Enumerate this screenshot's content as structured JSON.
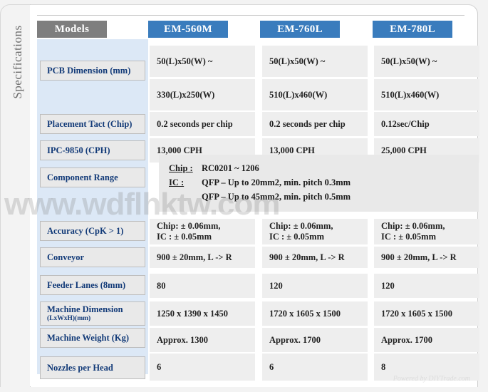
{
  "side_label": "Specifications",
  "header": {
    "spec_column_label": "Models",
    "models": [
      "EM-560M",
      "EM-760L",
      "EM-780L"
    ],
    "models_badge_color": "#7e7e7e",
    "model_badge_color": "#3a7cbd"
  },
  "rows": [
    {
      "label": "PCB Dimension (mm)",
      "sub": "",
      "values_top": [
        "50(L)x50(W) ~",
        "50(L)x50(W) ~",
        "50(L)x50(W) ~"
      ],
      "values_bottom": [
        "330(L)x250(W)",
        "510(L)x460(W)",
        "510(L)x460(W)"
      ]
    },
    {
      "label": "Placement Tact (Chip)",
      "sub": "",
      "values": [
        "0.2 seconds per chip",
        "0.2 seconds per chip",
        "0.12sec/Chip"
      ]
    },
    {
      "label": "IPC-9850 (CPH)",
      "sub": "",
      "values": [
        "13,000 CPH",
        "13,000 CPH",
        "25,000 CPH"
      ]
    },
    {
      "label": "Component Range",
      "sub": "",
      "merged": true
    },
    {
      "label": "Accuracy (CpK > 1)",
      "sub": "",
      "values": [
        "Chip: ± 0.06mm,\nIC : ± 0.05mm",
        "Chip: ± 0.06mm,\nIC : ± 0.05mm",
        "Chip: ± 0.06mm,\nIC : ± 0.05mm"
      ]
    },
    {
      "label": "Conveyor",
      "sub": "",
      "values": [
        "900 ± 20mm, L -> R",
        "900 ± 20mm, L -> R",
        "900 ± 20mm, L -> R"
      ]
    },
    {
      "label": "Feeder Lanes (8mm)",
      "sub": "",
      "values": [
        "80",
        "120",
        "120"
      ]
    },
    {
      "label": "Machine Dimension",
      "sub": "(LxWxH)(mm)",
      "values": [
        "1250 x 1390 x 1450",
        "1720 x 1605 x 1500",
        "1720 x 1605 x 1500"
      ]
    },
    {
      "label": "Machine Weight (Kg)",
      "sub": "",
      "values": [
        "Approx. 1300",
        "Approx. 1700",
        "Approx. 1700"
      ]
    },
    {
      "label": "Nozzles per Head",
      "sub": "",
      "values": [
        "6",
        "6",
        "8"
      ]
    }
  ],
  "component_range": {
    "lines": [
      {
        "key": "Chip :",
        "value": "RC0201 ~  1206"
      },
      {
        "key": "IC :",
        "value": "QFP – Up to 20mm2, min. pitch 0.3mm"
      },
      {
        "key": "",
        "value": "QFP – Up to 45mm2, min. pitch 0.5mm"
      }
    ]
  },
  "watermark": "www.wdflhktw.com",
  "footer": "Powered by DIYTrade.com"
}
